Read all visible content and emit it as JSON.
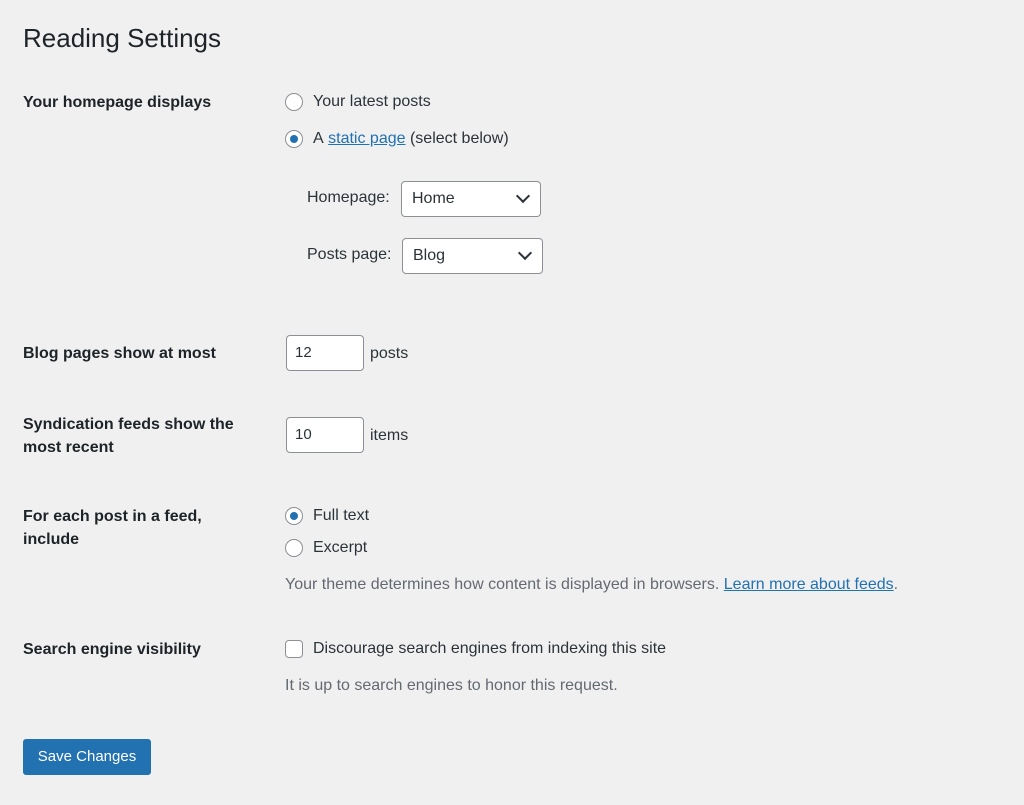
{
  "page_title": "Reading Settings",
  "homepage_displays": {
    "label": "Your homepage displays",
    "option_latest": "Your latest posts",
    "option_static_prefix": "A",
    "option_static_link": "static page",
    "option_static_suffix": "(select below)",
    "selected": "static",
    "homepage_label": "Homepage:",
    "homepage_value": "Home",
    "posts_page_label": "Posts page:",
    "posts_page_value": "Blog"
  },
  "blog_pages": {
    "label": "Blog pages show at most",
    "value": "12",
    "unit": "posts"
  },
  "syndication": {
    "label": "Syndication feeds show the most recent",
    "value": "10",
    "unit": "items"
  },
  "feed_include": {
    "label": "For each post in a feed, include",
    "option_full": "Full text",
    "option_excerpt": "Excerpt",
    "selected": "full",
    "desc_text": "Your theme determines how content is displayed in browsers.",
    "desc_link": "Learn more about feeds",
    "desc_end": "."
  },
  "search_visibility": {
    "label": "Search engine visibility",
    "checkbox_label": "Discourage search engines from indexing this site",
    "checked": false,
    "desc": "It is up to search engines to honor this request."
  },
  "save_button": "Save Changes",
  "colors": {
    "accent": "#2271b1",
    "background": "#f0f0f1",
    "text": "#1d2327",
    "muted": "#646970"
  }
}
